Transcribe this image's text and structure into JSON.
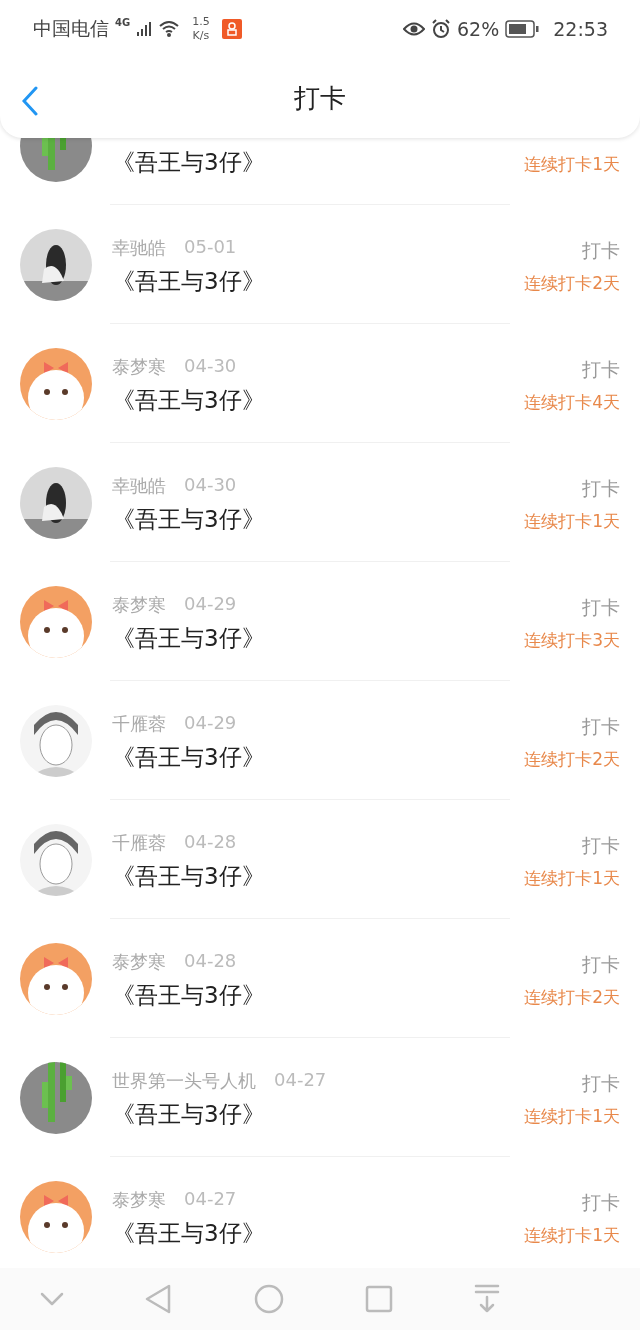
{
  "status_bar": {
    "carrier": "中国电信",
    "network": "4G",
    "speed_value": "1.5",
    "speed_unit": "K/s",
    "battery": "62%",
    "time": "22:53"
  },
  "header": {
    "title": "打卡"
  },
  "rows": [
    {
      "avatar": {
        "kind": "sprout"
      },
      "title": "《吾王与3仔》",
      "streak": "连续打卡1天"
    },
    {
      "name": "幸驰皓",
      "date": "05-01",
      "action": "打卡",
      "title": "《吾王与3仔》",
      "streak": "连续打卡2天"
    },
    {
      "avatar": {
        "kind": "dog"
      },
      "name": "泰梦寒",
      "date": "04-30",
      "action": "打卡",
      "title": "《吾王与3仔》",
      "streak": "连续打卡4天"
    },
    {
      "name": "幸驰皓",
      "date": "04-30",
      "action": "打卡",
      "title": "《吾王与3仔》",
      "streak": "连续打卡1天"
    },
    {
      "avatar": {
        "kind": "dog"
      },
      "name": "泰梦寒",
      "date": "04-29",
      "action": "打卡",
      "title": "《吾王与3仔》",
      "streak": "连续打卡3天"
    },
    {
      "avatar": {
        "kind": "sketch"
      },
      "name": "千雁蓉",
      "date": "04-29",
      "action": "打卡",
      "title": "《吾王与3仔》",
      "streak": "连续打卡2天"
    },
    {
      "avatar": {
        "kind": "sketch"
      },
      "name": "千雁蓉",
      "date": "04-28",
      "action": "打卡",
      "title": "《吾王与3仔》",
      "streak": "连续打卡1天"
    },
    {
      "avatar": {
        "kind": "dog"
      },
      "name": "泰梦寒",
      "date": "04-28",
      "action": "打卡",
      "title": "《吾王与3仔》",
      "streak": "连续打卡2天"
    },
    {
      "avatar": {
        "kind": "sprout"
      },
      "name": "世界第一头号人机",
      "date": "04-27",
      "action": "打卡",
      "title": "《吾王与3仔》",
      "streak": "连续打卡1天"
    },
    {
      "avatar": {
        "kind": "dog"
      },
      "name": "泰梦寒",
      "date": "04-27",
      "action": "打卡",
      "title": "《吾王与3仔》",
      "streak": "连续打卡1天"
    }
  ]
}
